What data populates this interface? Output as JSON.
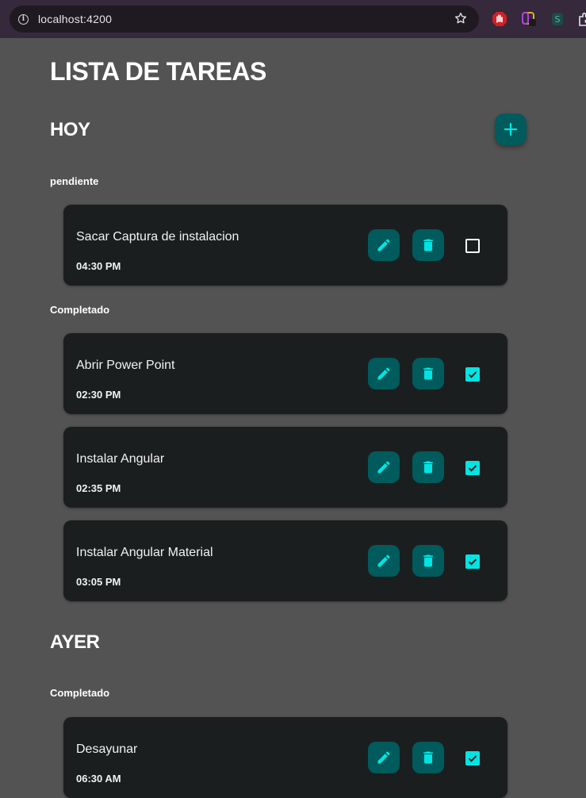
{
  "browser": {
    "url": "localhost:4200"
  },
  "app": {
    "title": "LISTA DE TAREAS",
    "add_icon": "plus-icon",
    "accent_color": "#00e5e3",
    "button_color": "#015a5b",
    "card_color": "#1b1e1f",
    "background_color": "#535353"
  },
  "sections": [
    {
      "title": "HOY",
      "groups": [
        {
          "label": "pendiente",
          "tasks": [
            {
              "title": "Sacar Captura de instalacion",
              "time": "04:30 PM",
              "completed": false
            }
          ]
        },
        {
          "label": "Completado",
          "tasks": [
            {
              "title": "Abrir Power Point",
              "time": "02:30 PM",
              "completed": true
            },
            {
              "title": "Instalar Angular",
              "time": "02:35 PM",
              "completed": true
            },
            {
              "title": "Instalar Angular Material",
              "time": "03:05 PM",
              "completed": true
            }
          ]
        }
      ]
    },
    {
      "title": "AYER",
      "groups": [
        {
          "label": "Completado",
          "tasks": [
            {
              "title": "Desayunar",
              "time": "06:30 AM",
              "completed": true
            }
          ]
        }
      ]
    }
  ]
}
